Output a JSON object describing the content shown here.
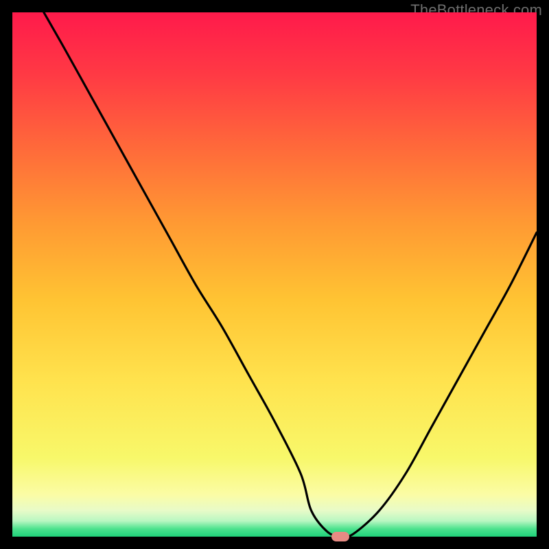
{
  "watermark": "TheBottleneck.com",
  "colors": {
    "frame": "#000000",
    "watermark": "#6e6e6e",
    "curve": "#000000",
    "marker": "#e78b84",
    "gradient_stops": [
      "#ff1a4b",
      "#ff3a44",
      "#ff6a3a",
      "#ff9933",
      "#ffc433",
      "#ffe24d",
      "#f8f86a",
      "#fbfca5",
      "#e8fbc8",
      "#b9f7c2",
      "#4de28e",
      "#1fd27a"
    ]
  },
  "chart_data": {
    "type": "line",
    "title": "",
    "xlabel": "",
    "ylabel": "",
    "xlim": [
      0,
      100
    ],
    "ylim": [
      0,
      100
    ],
    "notes": "V-shaped curve; y is deviation-style value that bottoms out at x≈62.5. Left-coming branch descends almost linearly from (6,100) to a flat minimum run near y≈0 across x≈57–65, then the right branch rises convexly to (100,58). No axes, ticks, legend shown.",
    "series": [
      {
        "name": "curve",
        "x": [
          6,
          10,
          15,
          20,
          25,
          30,
          35,
          40,
          45,
          50,
          55,
          57,
          60,
          62.5,
          65,
          70,
          75,
          80,
          85,
          90,
          95,
          100
        ],
        "y": [
          100,
          93,
          84,
          75,
          66,
          57,
          48,
          40,
          31,
          22,
          12,
          5,
          1,
          0,
          0.5,
          5,
          12,
          21,
          30,
          39,
          48,
          58
        ]
      }
    ],
    "marker": {
      "x": 62.5,
      "y": 0
    },
    "flat_run": {
      "x_start": 57,
      "x_end": 65,
      "y": 0
    }
  }
}
